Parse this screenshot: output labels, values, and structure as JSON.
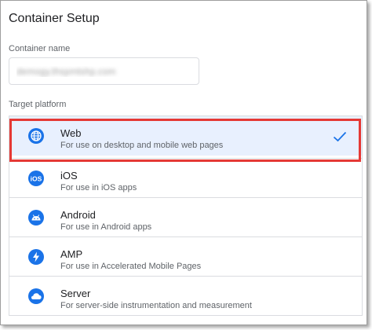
{
  "panel": {
    "title": "Container Setup"
  },
  "container_name": {
    "label": "Container name",
    "value": "demogy.thspmtshp.com"
  },
  "target_platform": {
    "label": "Target platform",
    "options": [
      {
        "name": "Web",
        "description": "For use on desktop and mobile web pages",
        "icon": "globe-icon",
        "selected": true
      },
      {
        "name": "iOS",
        "description": "For use in iOS apps",
        "icon": "ios-icon",
        "selected": false
      },
      {
        "name": "Android",
        "description": "For use in Android apps",
        "icon": "android-icon",
        "selected": false
      },
      {
        "name": "AMP",
        "description": "For use in Accelerated Mobile Pages",
        "icon": "amp-lightning-icon",
        "selected": false
      },
      {
        "name": "Server",
        "description": "For server-side instrumentation and measurement",
        "icon": "cloud-icon",
        "selected": false
      }
    ]
  },
  "colors": {
    "accent": "#1a73e8",
    "selected_background": "#e8f0fe",
    "highlight_border": "#e53935"
  }
}
